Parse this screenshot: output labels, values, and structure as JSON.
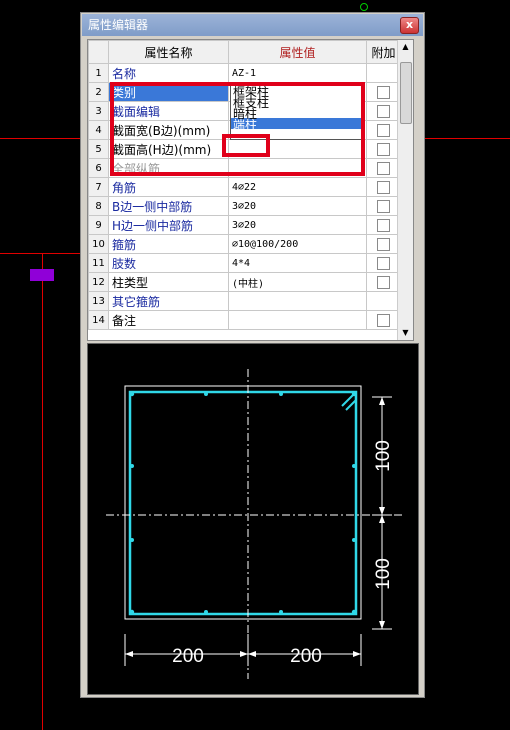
{
  "window": {
    "title": "属性编辑器",
    "close_label": "x"
  },
  "table": {
    "headers": {
      "name": "属性名称",
      "value": "属性值",
      "extra": "附加"
    },
    "rows": [
      {
        "num": "1",
        "name": "名称",
        "value": "AZ-1",
        "checkbox": false,
        "style": "blue"
      },
      {
        "num": "2",
        "name": "类别",
        "value": "暗柱",
        "checkbox": true,
        "style": "selected"
      },
      {
        "num": "3",
        "name": "截面编辑",
        "value": "",
        "checkbox": true,
        "style": "blue"
      },
      {
        "num": "4",
        "name": "截面宽(B边)(mm)",
        "value": "",
        "checkbox": true,
        "style": "black"
      },
      {
        "num": "5",
        "name": "截面高(H边)(mm)",
        "value": "",
        "checkbox": true,
        "style": "black"
      },
      {
        "num": "6",
        "name": "全部纵筋",
        "value": "",
        "checkbox": true,
        "style": "gray"
      },
      {
        "num": "7",
        "name": "角筋",
        "value": "4⌀22",
        "checkbox": true,
        "style": "blue"
      },
      {
        "num": "8",
        "name": "B边一侧中部筋",
        "value": "3⌀20",
        "checkbox": true,
        "style": "blue"
      },
      {
        "num": "9",
        "name": "H边一侧中部筋",
        "value": "3⌀20",
        "checkbox": true,
        "style": "blue"
      },
      {
        "num": "10",
        "name": "箍筋",
        "value": "⌀10@100/200",
        "checkbox": true,
        "style": "blue"
      },
      {
        "num": "11",
        "name": "肢数",
        "value": "4*4",
        "checkbox": true,
        "style": "blue"
      },
      {
        "num": "12",
        "name": "柱类型",
        "value": "(中柱)",
        "checkbox": true,
        "style": "black"
      },
      {
        "num": "13",
        "name": "其它箍筋",
        "value": "",
        "checkbox": false,
        "style": "blue"
      },
      {
        "num": "14",
        "name": "备注",
        "value": "",
        "checkbox": true,
        "style": "black"
      }
    ]
  },
  "dropdown": {
    "options": [
      "框架柱",
      "框支柱",
      "暗柱",
      "端柱"
    ],
    "highlighted_index": 3
  },
  "preview": {
    "dim_width_left": "200",
    "dim_width_right": "200",
    "dim_height_top": "100",
    "dim_height_bottom": "100"
  },
  "colors": {
    "highlight_box": "#e0001a",
    "rebar": "#30d8e8",
    "header_value_bg": "#f6d98a"
  }
}
